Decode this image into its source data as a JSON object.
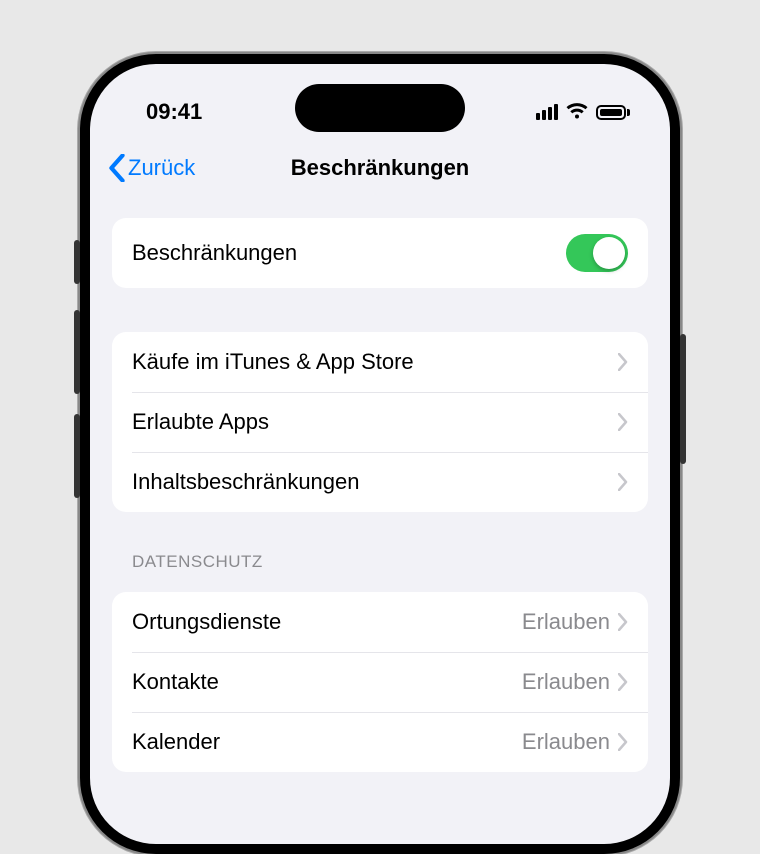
{
  "status": {
    "time": "09:41"
  },
  "nav": {
    "back_label": "Zurück",
    "title": "Beschränkungen"
  },
  "toggle_row": {
    "label": "Beschränkungen",
    "on": true
  },
  "section1": {
    "items": [
      {
        "label": "Käufe im iTunes & App Store"
      },
      {
        "label": "Erlaubte Apps"
      },
      {
        "label": "Inhaltsbeschränkungen"
      }
    ]
  },
  "section2": {
    "header": "DATENSCHUTZ",
    "items": [
      {
        "label": "Ortungsdienste",
        "value": "Erlauben"
      },
      {
        "label": "Kontakte",
        "value": "Erlauben"
      },
      {
        "label": "Kalender",
        "value": "Erlauben"
      }
    ]
  }
}
